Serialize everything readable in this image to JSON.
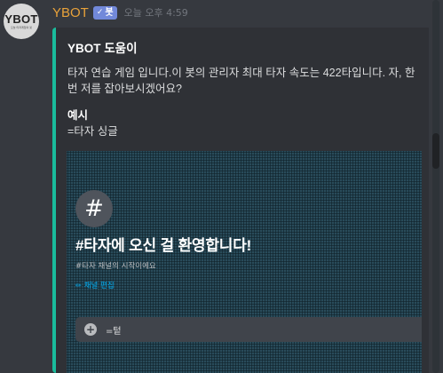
{
  "message": {
    "avatar_logo": "YBOT",
    "avatar_subtext": "오늘 타자게임의 봇",
    "username": "YBOT",
    "bot_tag": {
      "check": "✓",
      "label": "봇"
    },
    "timestamp": "오늘 오후 4:59",
    "username_color": "#e8a23a"
  },
  "embed": {
    "accent_color": "#1abc9c",
    "title": "YBOT 도움이",
    "description": "타자 연습 게임 입니다.이 봇의 관리자 최대 타자 속도는 422타입니다. 자, 한번 저를 잡아보시겠어요?",
    "field_name": "예시",
    "field_value": "=타자 싱글"
  },
  "embed_image": {
    "hash_icon": "#",
    "welcome_title": "#타자에 오신 걸 환영합니다!",
    "welcome_sub": "#타자 채널의 시작이에요",
    "edit_label": "채널 편집",
    "pencil_icon": "✏",
    "plus_icon": "+",
    "composer_text": "=텉"
  }
}
